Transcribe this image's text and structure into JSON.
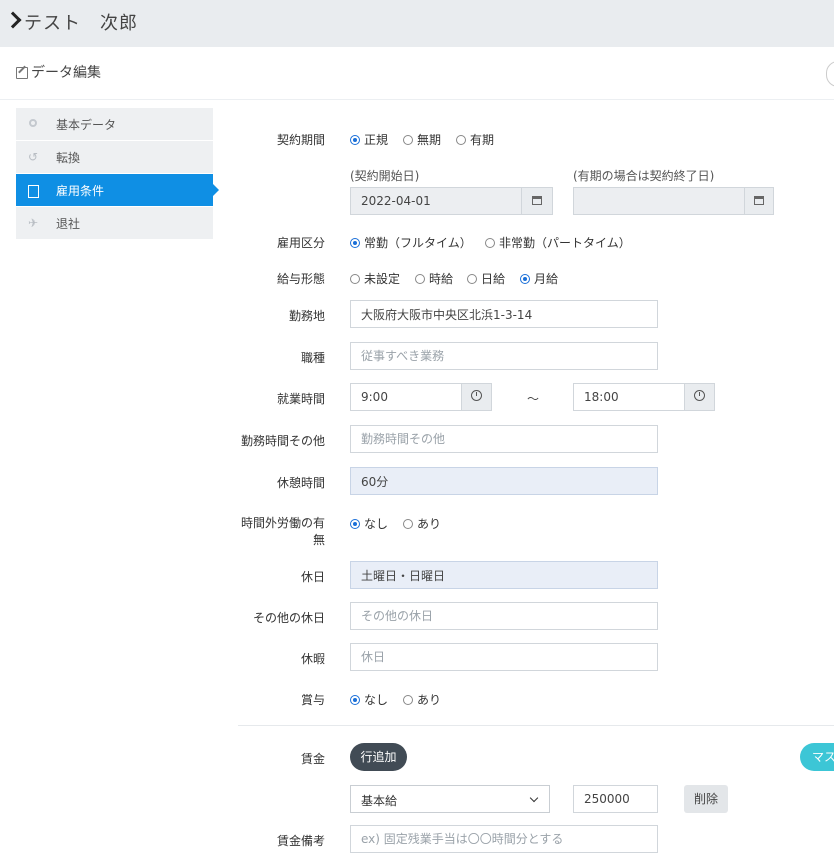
{
  "header": {
    "title": "テスト　次郎"
  },
  "subheader": {
    "title": "データ編集"
  },
  "sidebar": {
    "items": [
      {
        "label": "基本データ",
        "icon": "gear-icon"
      },
      {
        "label": "転換",
        "icon": "undo-icon"
      },
      {
        "label": "雇用条件",
        "icon": "document-icon",
        "active": true
      },
      {
        "label": "退社",
        "icon": "plane-icon"
      }
    ]
  },
  "form": {
    "contract_period": {
      "label": "契約期間",
      "options": [
        "正規",
        "無期",
        "有期"
      ],
      "selected": "正規"
    },
    "start_date": {
      "hint": "(契約開始日)",
      "value": "2022-04-01"
    },
    "end_date": {
      "hint": "(有期の場合は契約終了日)",
      "value": ""
    },
    "employment_type": {
      "label": "雇用区分",
      "options": [
        "常勤（フルタイム）",
        "非常勤（パートタイム）"
      ],
      "selected": "常勤（フルタイム）"
    },
    "pay_form": {
      "label": "給与形態",
      "options": [
        "未設定",
        "時給",
        "日給",
        "月給"
      ],
      "selected": "月給"
    },
    "workplace": {
      "label": "勤務地",
      "value": "大阪府大阪市中央区北浜1-3-14"
    },
    "occupation": {
      "label": "職種",
      "placeholder": "従事すべき業務"
    },
    "work_hours": {
      "label": "就業時間",
      "start": "9:00",
      "tilde": "～",
      "end": "18:00"
    },
    "work_hours_other": {
      "label": "勤務時間その他",
      "placeholder": "勤務時間その他"
    },
    "break_time": {
      "label": "休憩時間",
      "value": "60分"
    },
    "overtime": {
      "label_line1": "時間外労働の有",
      "label_line2": "無",
      "options": [
        "なし",
        "あり"
      ],
      "selected": "なし"
    },
    "holiday": {
      "label": "休日",
      "value": "土曜日・日曜日"
    },
    "other_holiday": {
      "label": "その他の休日",
      "placeholder": "その他の休日"
    },
    "leave": {
      "label": "休暇",
      "placeholder": "休日"
    },
    "bonus": {
      "label": "賞与",
      "options": [
        "なし",
        "あり"
      ],
      "selected": "なし"
    },
    "wage": {
      "label": "賃金",
      "add_row": "行追加",
      "master": "マスタ",
      "type": "基本給",
      "amount": "250000",
      "delete": "削除"
    },
    "wage_note": {
      "label": "賃金備考",
      "placeholder": "ex) 固定残業手当は〇〇時間分とする"
    }
  }
}
